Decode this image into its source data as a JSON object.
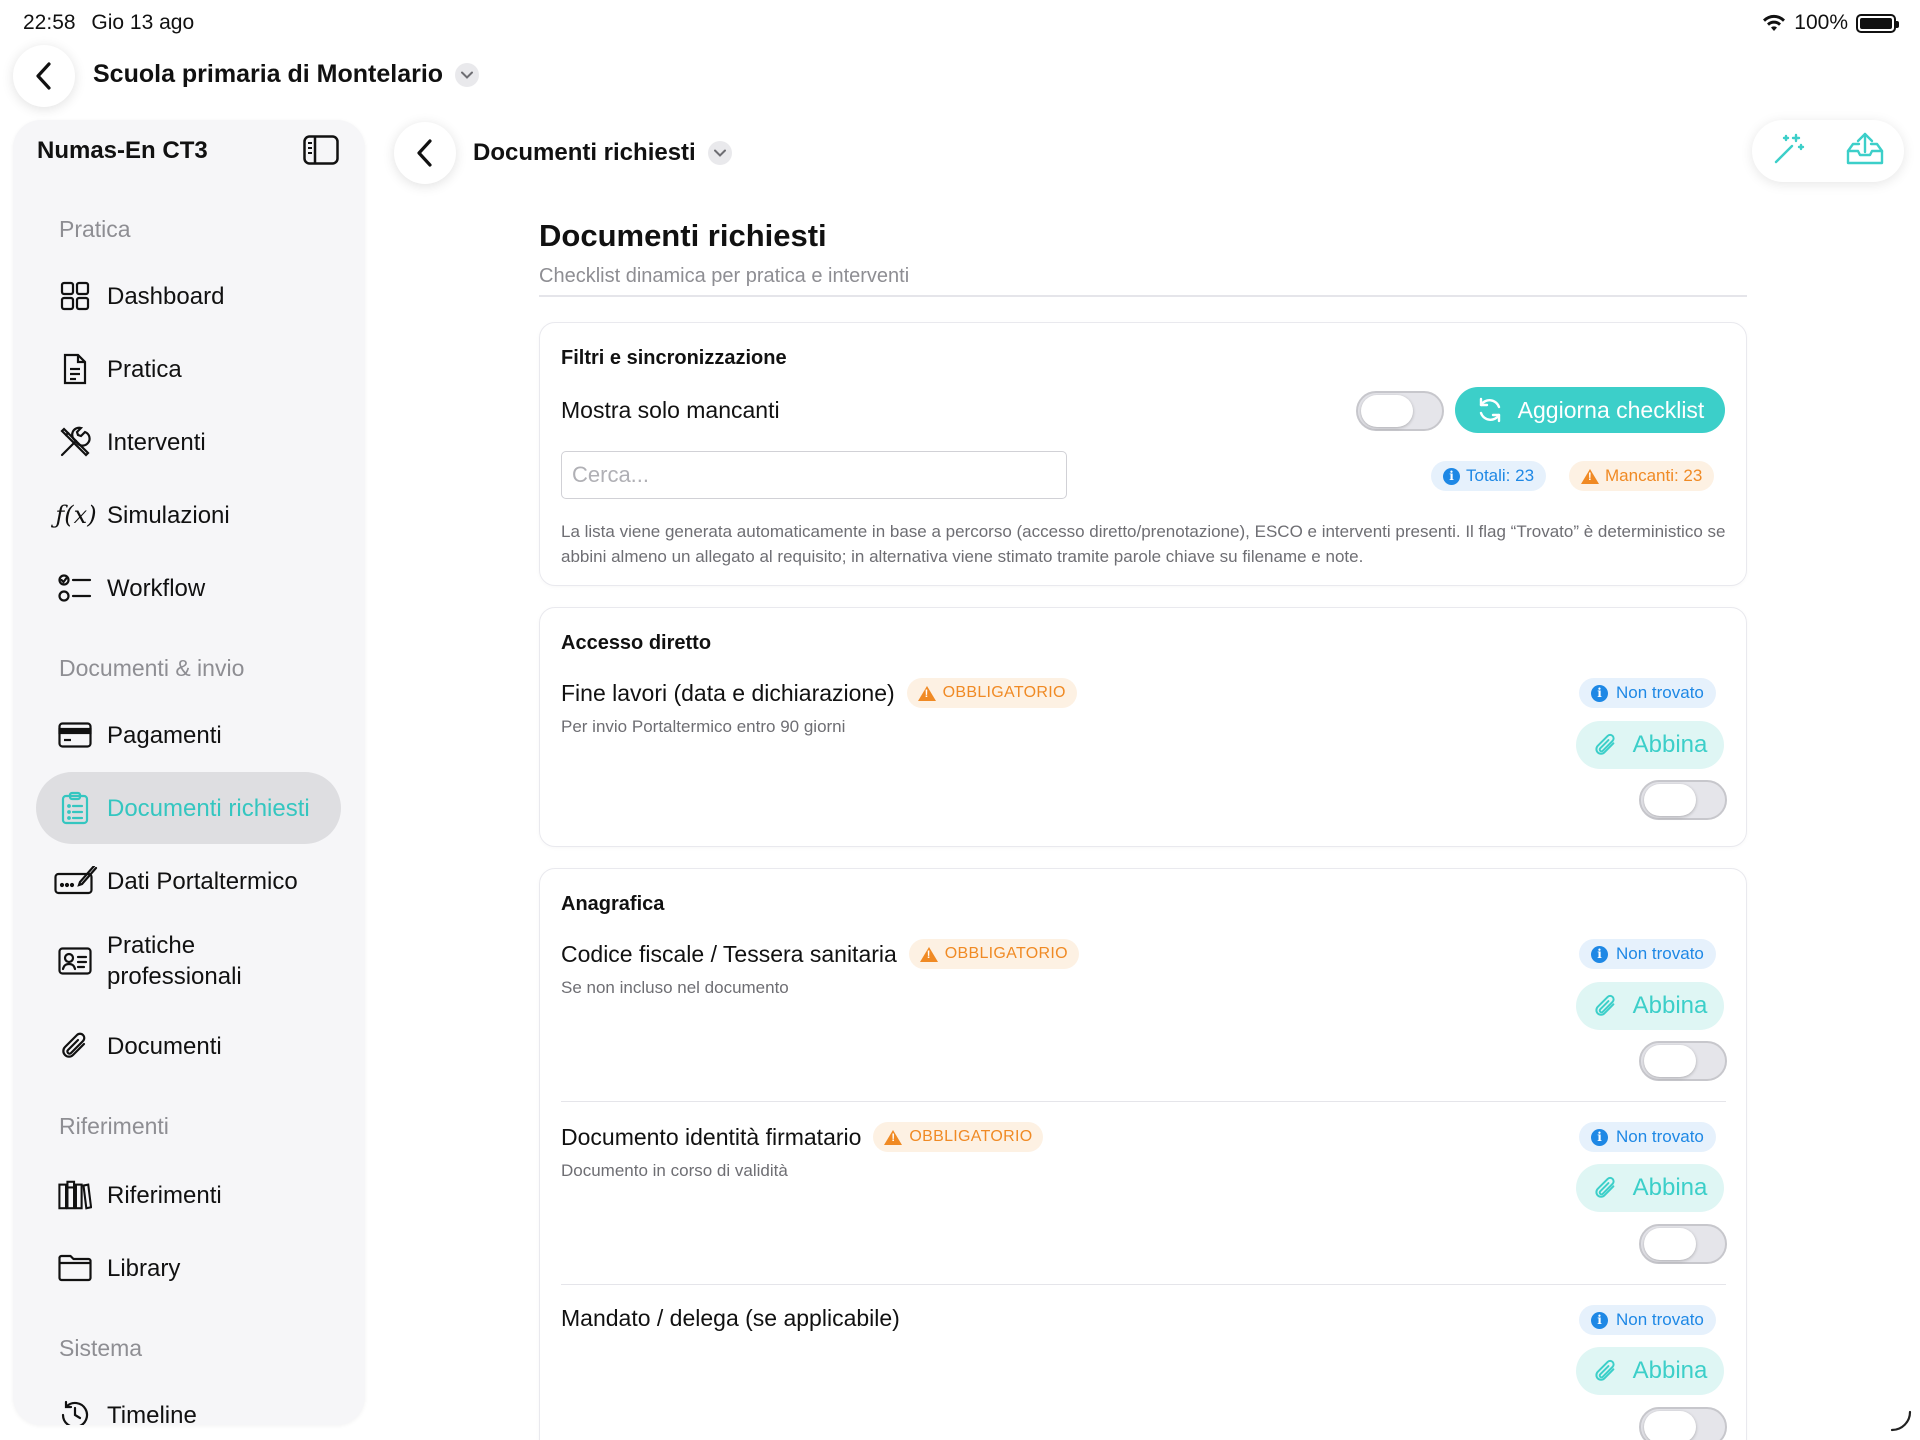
{
  "status_bar": {
    "time": "22:58",
    "date": "Gio 13 ago",
    "battery": "100%"
  },
  "top_nav": {
    "project_title": "Scuola primaria di Montelario"
  },
  "sidebar": {
    "title": "Numas-En CT3",
    "sections": [
      {
        "label": "Pratica"
      },
      {
        "label": "Documenti & invio"
      },
      {
        "label": "Riferimenti"
      },
      {
        "label": "Sistema"
      }
    ],
    "items": [
      {
        "label": "Dashboard",
        "icon": "dashboard-grid-icon"
      },
      {
        "label": "Pratica",
        "icon": "document-icon"
      },
      {
        "label": "Interventi",
        "icon": "tools-icon"
      },
      {
        "label": "Simulazioni",
        "icon": "function-icon"
      },
      {
        "label": "Workflow",
        "icon": "checklist-icon"
      },
      {
        "label": "Pagamenti",
        "icon": "credit-card-icon"
      },
      {
        "label": "Documenti richiesti",
        "icon": "clipboard-icon",
        "active": true
      },
      {
        "label": "Dati Portaltermico",
        "icon": "signature-icon"
      },
      {
        "label": "Pratiche professionali",
        "icon": "id-card-icon"
      },
      {
        "label": "Documenti",
        "icon": "paperclip-icon"
      },
      {
        "label": "Riferimenti",
        "icon": "books-icon"
      },
      {
        "label": "Library",
        "icon": "folder-icon"
      },
      {
        "label": "Timeline",
        "icon": "history-icon"
      }
    ]
  },
  "content_header": {
    "title": "Documenti richiesti"
  },
  "page": {
    "title": "Documenti richiesti",
    "subtitle": "Checklist dinamica per pratica e interventi"
  },
  "filters": {
    "heading": "Filtri e sincronizzazione",
    "toggle_label": "Mostra solo mancanti",
    "refresh_label": "Aggiorna checklist",
    "search_placeholder": "Cerca...",
    "total_pill": "Totali: 23",
    "missing_pill": "Mancanti: 23",
    "note": "La lista viene generata automaticamente in base a percorso (accesso diretto/prenotazione), ESCO e interventi presenti. Il flag “Trovato” è deterministico se abbini almeno un allegato al requisito; in alternativa viene stimato tramite parole chiave su filename e note."
  },
  "accesso_diretto": {
    "heading": "Accesso diretto",
    "items": [
      {
        "name": "Fine lavori (data e dichiarazione)",
        "badge": "OBBLIGATORIO",
        "desc": "Per invio Portaltermico entro 90 giorni",
        "status": "Non trovato",
        "action": "Abbina"
      }
    ]
  },
  "anagrafica": {
    "heading": "Anagrafica",
    "items": [
      {
        "name": "Codice fiscale / Tessera sanitaria",
        "badge": "OBBLIGATORIO",
        "desc": "Se non incluso nel documento",
        "status": "Non trovato",
        "action": "Abbina"
      },
      {
        "name": "Documento identità firmatario",
        "badge": "OBBLIGATORIO",
        "desc": "Documento in corso di validità",
        "status": "Non trovato",
        "action": "Abbina"
      },
      {
        "name": "Mandato / delega (se applicabile)",
        "status": "Non trovato",
        "action": "Abbina"
      }
    ]
  },
  "colors": {
    "accent": "#3CCFC9",
    "info_blue": "#1E88E5",
    "warning_orange": "#F08A24"
  }
}
